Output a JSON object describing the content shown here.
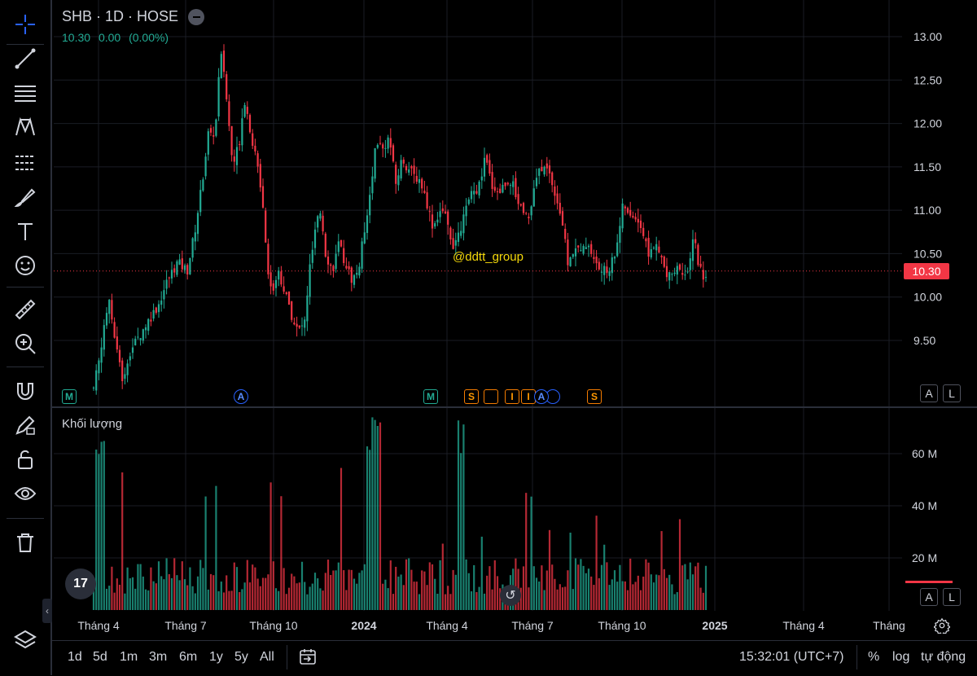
{
  "header": {
    "symbol": "SHB · 1D · HOSE"
  },
  "quote": {
    "last": "10.30",
    "change": "0.00",
    "change_pct": "(0.00%)"
  },
  "price_axis": [
    "13.00",
    "12.50",
    "12.00",
    "11.50",
    "11.00",
    "10.50",
    "10.00",
    "9.50"
  ],
  "current_price_tag": "10.30",
  "watermark": "@ddtt_group",
  "volume_pane": {
    "title": "Khối lượng",
    "axis": [
      "60 M",
      "40 M",
      "20 M"
    ]
  },
  "time_axis": [
    "Tháng 4",
    "Tháng 7",
    "Tháng 10",
    "2024",
    "Tháng 4",
    "Tháng 7",
    "Tháng 10",
    "2025",
    "Tháng 4",
    "Tháng"
  ],
  "events": [
    "M",
    "A",
    "M",
    "S",
    "I",
    "I",
    "A",
    "S"
  ],
  "scale_buttons": {
    "auto": "A",
    "log": "L"
  },
  "ranges": [
    "1d",
    "5d",
    "1m",
    "3m",
    "6m",
    "1y",
    "5y",
    "All"
  ],
  "clock": "15:32:01 (UTC+7)",
  "bottom_options": {
    "percent": "%",
    "log": "log",
    "auto": "tự động"
  },
  "tv_logo": "17",
  "colors": {
    "up": "#22ab94",
    "down": "#f23645",
    "grid": "#1a1d25",
    "bg": "#000000",
    "watermark": "#f5d90a"
  },
  "icons": [
    "crosshair-icon",
    "trend-line-icon",
    "horizontal-lines-icon",
    "pattern-icon",
    "fib-icon",
    "brush-icon",
    "text-icon",
    "emoji-icon",
    "ruler-icon",
    "zoom-in-icon",
    "magnet-icon",
    "lock-draw-icon",
    "unlock-icon",
    "eye-icon",
    "trash-icon",
    "layers-icon"
  ]
}
